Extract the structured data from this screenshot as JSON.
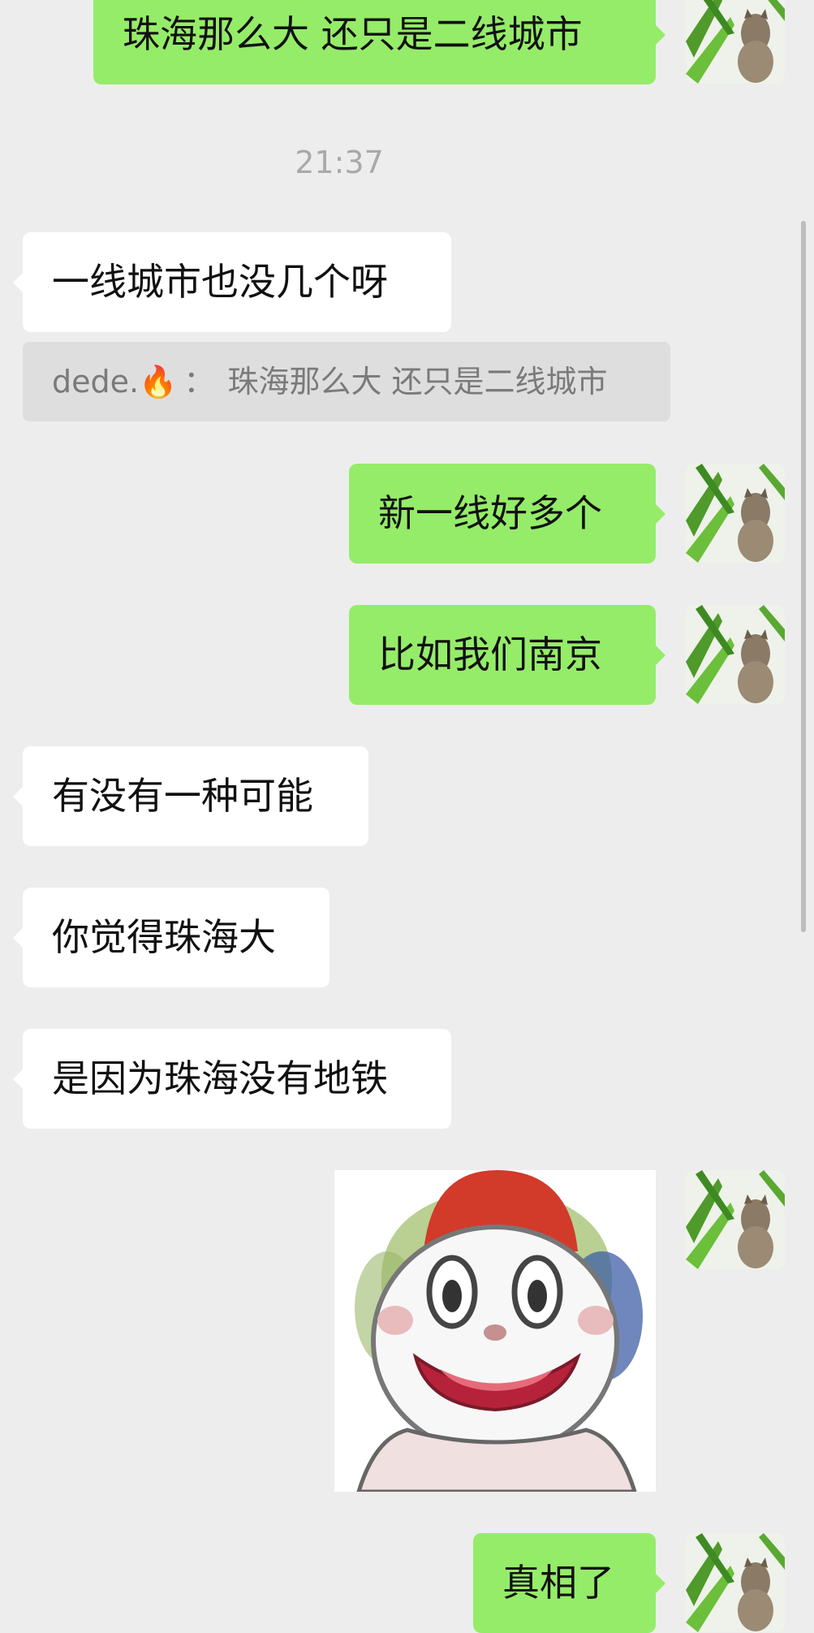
{
  "chat": {
    "timestamp": "21:37",
    "messages": [
      {
        "side": "out",
        "text": "珠海那么大 还只是二线城市"
      },
      {
        "side": "in",
        "text": "一线城市也没几个呀"
      },
      {
        "side": "out",
        "text": "新一线好多个"
      },
      {
        "side": "out",
        "text": "比如我们南京"
      },
      {
        "side": "in",
        "text": "有没有一种可能"
      },
      {
        "side": "in",
        "text": "你觉得珠海大"
      },
      {
        "side": "in",
        "text": "是因为珠海没有地铁"
      },
      {
        "side": "out",
        "type": "sticker",
        "sticker": "clown-face"
      },
      {
        "side": "out",
        "text": "真相了"
      }
    ],
    "quote": {
      "sender": "dede.",
      "sender_emoji": "🔥",
      "colon": "：",
      "text": "珠海那么大 还只是二线城市"
    }
  },
  "colors": {
    "background": "#ededed",
    "outgoing_bubble": "#95ec69",
    "incoming_bubble": "#ffffff",
    "quote_bg": "#dedede",
    "timestamp": "#a9a9a9"
  },
  "icons": {
    "avatar": "cat-in-leaves-avatar",
    "sticker": "clown-face-sticker",
    "fire": "fire-emoji"
  }
}
